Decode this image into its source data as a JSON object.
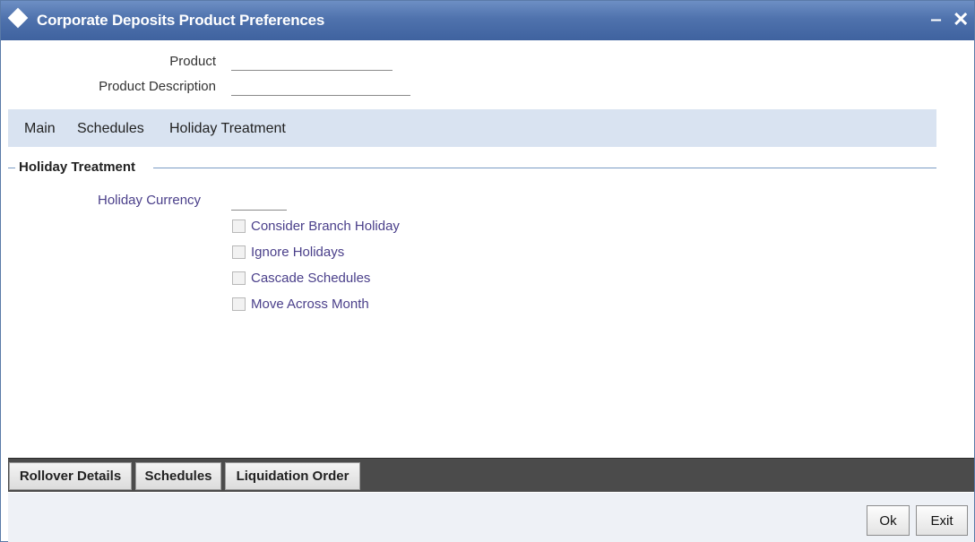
{
  "window": {
    "title": "Corporate Deposits Product Preferences",
    "minimize_glyph": "‒",
    "close_glyph": "✕"
  },
  "header_fields": {
    "product_label": "Product",
    "product_value": "",
    "product_description_label": "Product Description",
    "product_description_value": ""
  },
  "tabs": [
    {
      "label": "Main"
    },
    {
      "label": "Schedules"
    },
    {
      "label": "Holiday Treatment"
    }
  ],
  "holiday_section": {
    "title": "Holiday Treatment",
    "holiday_currency_label": "Holiday Currency",
    "holiday_currency_value": "",
    "checkboxes": [
      {
        "label": "Consider Branch Holiday",
        "checked": false
      },
      {
        "label": "Ignore Holidays",
        "checked": false
      },
      {
        "label": "Cascade Schedules",
        "checked": false
      },
      {
        "label": "Move Across Month",
        "checked": false
      }
    ]
  },
  "subsystem_buttons": [
    {
      "label": "Rollover Details"
    },
    {
      "label": "Schedules"
    },
    {
      "label": "Liquidation Order"
    }
  ],
  "actions": {
    "ok_label": "Ok",
    "exit_label": "Exit"
  },
  "colors": {
    "titlebar": "#4f72ad",
    "tabstrip": "#d9e3f1",
    "label_accent": "#4a3f8a",
    "bottom_bar": "#4b4b4b"
  }
}
